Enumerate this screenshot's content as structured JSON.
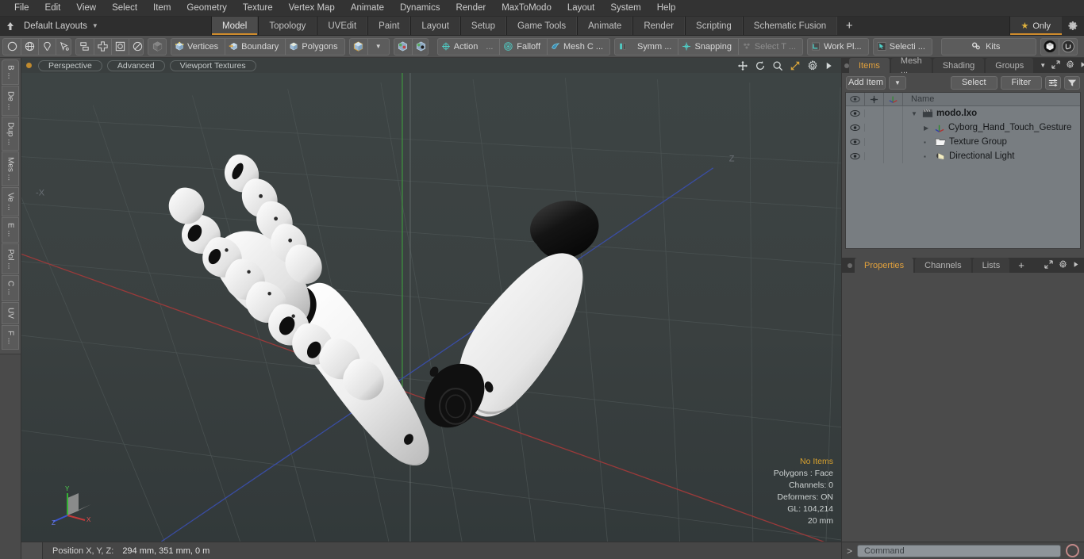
{
  "menubar": {
    "items": [
      "File",
      "Edit",
      "View",
      "Select",
      "Item",
      "Geometry",
      "Texture",
      "Vertex Map",
      "Animate",
      "Dynamics",
      "Render",
      "MaxToModo",
      "Layout",
      "System",
      "Help"
    ]
  },
  "layoutbar": {
    "layout_select": "Default Layouts",
    "tabs": [
      {
        "label": "Model",
        "active": true
      },
      {
        "label": "Topology",
        "active": false
      },
      {
        "label": "UVEdit",
        "active": false
      },
      {
        "label": "Paint",
        "active": false
      },
      {
        "label": "Layout",
        "active": false
      },
      {
        "label": "Setup",
        "active": false
      },
      {
        "label": "Game Tools",
        "active": false
      },
      {
        "label": "Animate",
        "active": false
      },
      {
        "label": "Render",
        "active": false
      },
      {
        "label": "Scripting",
        "active": false
      },
      {
        "label": "Schematic Fusion",
        "active": false
      }
    ],
    "add_tab": "+",
    "only_label": "Only"
  },
  "toolbar": {
    "selection_modes": [
      "circle-select-icon",
      "globe-select-icon",
      "lasso-select-icon",
      "paint-select-icon"
    ],
    "component_modes": [
      "connected-icon",
      "center-icon",
      "box-icon",
      "circle-icon"
    ],
    "element_toggle": "cube-icon",
    "groups": [
      {
        "label": "Vertices",
        "icon": "vertices-cube-icon"
      },
      {
        "label": "Boundary",
        "icon": "boundary-cube-icon"
      },
      {
        "label": "Polygons",
        "icon": "polygons-cube-icon"
      }
    ],
    "mode_cube": "cube-icon",
    "mode_caret": "chevron-down-icon",
    "items": [
      {
        "label": "Action",
        "icon": "action-center-icon",
        "truncated": "..."
      },
      {
        "label": "Falloff",
        "icon": "falloff-icon"
      },
      {
        "label": "Mesh C ...",
        "icon": "mesh-constraint-icon"
      },
      {
        "label": "Symm ...",
        "icon": "symmetry-icon"
      },
      {
        "label": "Snapping",
        "icon": "snapping-icon"
      },
      {
        "label": "Select T ...",
        "icon": "select-through-icon",
        "dim": true
      },
      {
        "label": "Work Pl...",
        "icon": "work-plane-icon"
      },
      {
        "label": "Selecti ...",
        "icon": "selection-set-icon"
      },
      {
        "label": "Kits",
        "icon": "kits-gear-icon"
      }
    ],
    "right_icons": [
      "modo-logo-icon",
      "unreal-logo-icon"
    ]
  },
  "left_strip": {
    "tabs": [
      "B ...",
      "De ...",
      "Dup ...",
      "Mes ...",
      "Ve ...",
      "E ...",
      "Pol ...",
      "C ...",
      "UV",
      "F ..."
    ]
  },
  "viewport": {
    "header": {
      "view_mode": "Perspective",
      "shading": "Advanced",
      "textures": "Viewport Textures",
      "nav_icons": [
        "move-icon",
        "rotate-icon",
        "zoom-icon",
        "fit-icon",
        "gear-icon",
        "play-icon"
      ]
    },
    "stats": {
      "selection": "No Items",
      "polygons": "Polygons : Face",
      "channels": "Channels: 0",
      "deformers": "Deformers: ON",
      "gl": "GL: 104,214",
      "scale": "20 mm"
    },
    "gizmo": {
      "x": "X",
      "y": "Y",
      "z": "Z"
    },
    "colors": {
      "background_top": "#3b4242",
      "background_bottom": "#343a3a",
      "grid": "#4a5252",
      "axis_x": "#a24040",
      "axis_y": "#3e8c3e",
      "axis_z": "#3a4fa0"
    }
  },
  "statusbar": {
    "label": "Position X, Y, Z:",
    "value": "294 mm, 351 mm, 0 m"
  },
  "right_panel": {
    "tabs": [
      {
        "label": "Items",
        "active": true
      },
      {
        "label": "Mesh ...",
        "active": false
      },
      {
        "label": "Shading",
        "active": false
      },
      {
        "label": "Groups",
        "active": false
      }
    ],
    "tab_icons": [
      "chevron-down-icon",
      "expand-icon",
      "gear-icon",
      "play-icon"
    ],
    "toolbar": {
      "add_item": "Add Item",
      "add_caret": "chevron-down-icon",
      "select": "Select",
      "filter": "Filter",
      "list_icon": "list-options-icon",
      "funnel_icon": "funnel-icon"
    },
    "list_header": {
      "eye_col": "visibility-icon",
      "lock_col": "lock-icon",
      "axis_col": "transform-icon",
      "name": "Name"
    },
    "items": [
      {
        "label": "modo.lxo",
        "icon": "scene-icon",
        "indent": 0,
        "bold": true,
        "disclose": "open"
      },
      {
        "label": "Cyborg_Hand_Touch_Gesture",
        "icon": "mesh-axis-icon",
        "indent": 1,
        "bold": false,
        "disclose": "closed"
      },
      {
        "label": "Texture Group",
        "icon": "folder-icon",
        "indent": 1,
        "bold": false,
        "disclose": "none"
      },
      {
        "label": "Directional Light",
        "icon": "light-icon",
        "indent": 1,
        "bold": false,
        "disclose": "none"
      }
    ],
    "lower_tabs": [
      {
        "label": "Properties",
        "active": true
      },
      {
        "label": "Channels",
        "active": false
      },
      {
        "label": "Lists",
        "active": false
      },
      {
        "label": "+",
        "active": false
      }
    ],
    "lower_icons": [
      "expand-icon",
      "gear-icon",
      "play-icon"
    ]
  },
  "command_bar": {
    "chevron": ">",
    "placeholder": "Command",
    "record_icon": "record-circle-icon"
  }
}
